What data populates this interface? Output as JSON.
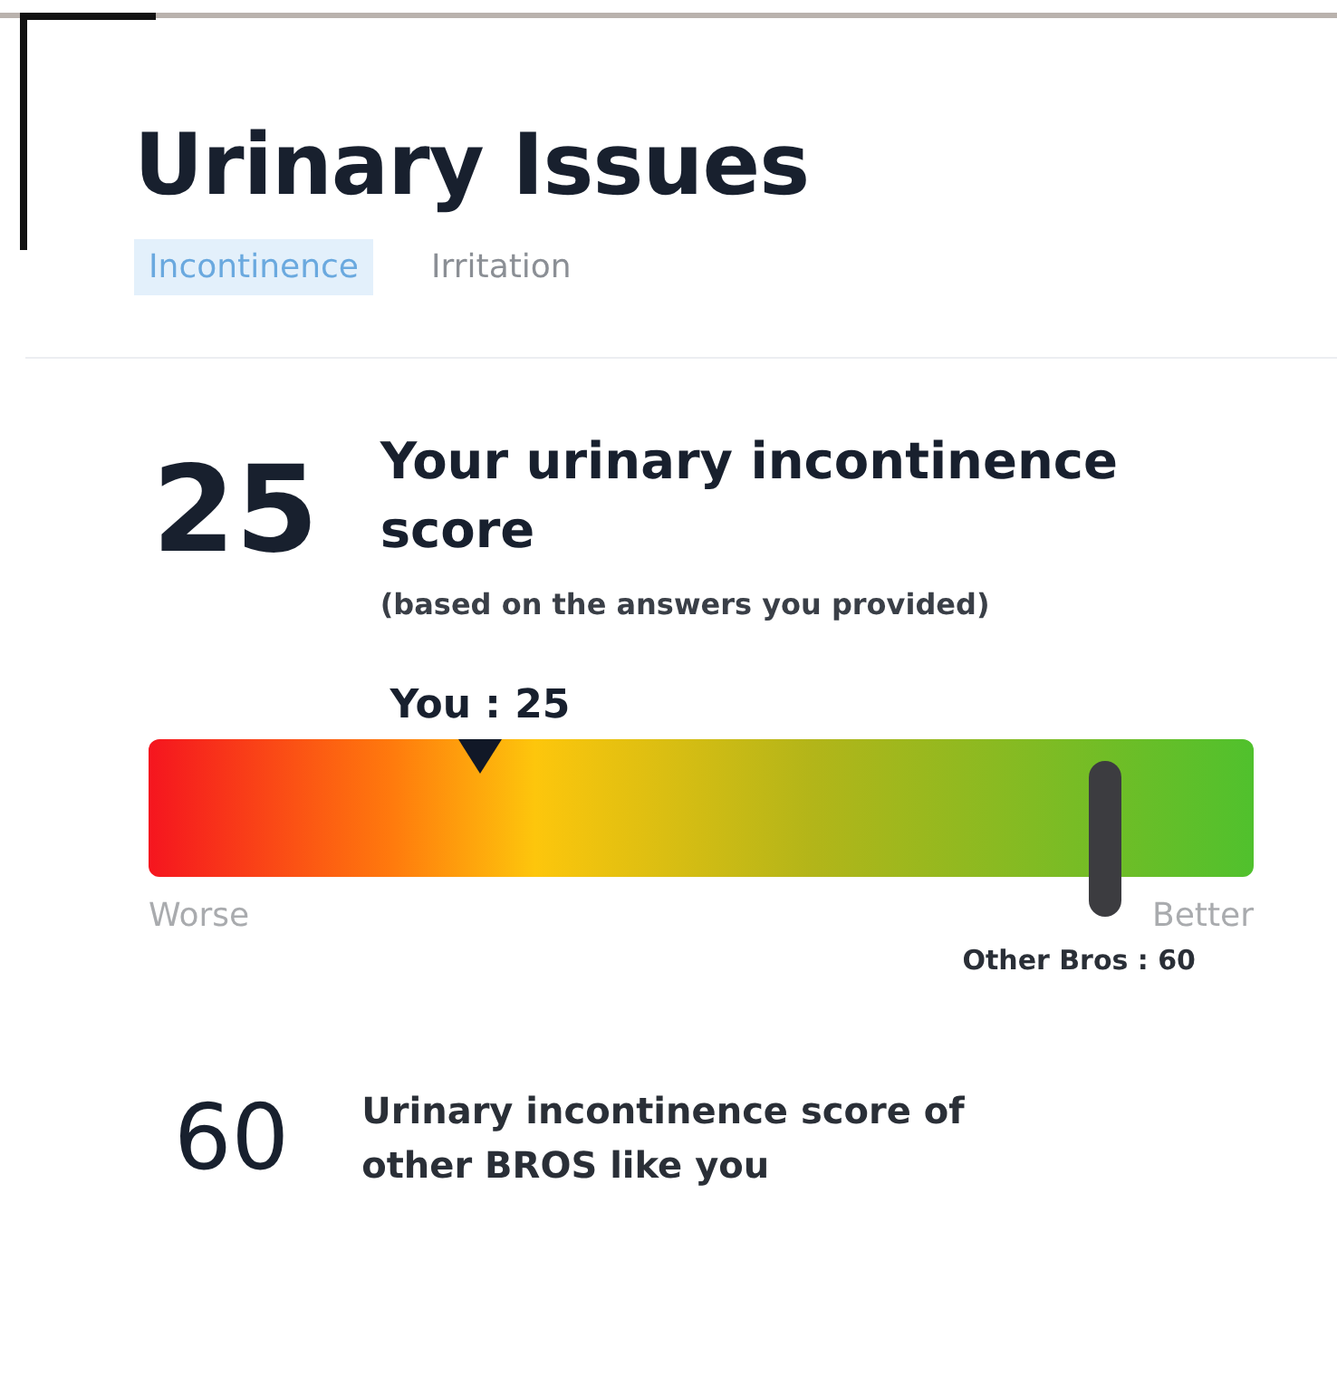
{
  "header": {
    "title": "Urinary Issues",
    "tabs": [
      {
        "label": "Incontinence",
        "selected": true
      },
      {
        "label": "Irritation",
        "selected": false
      }
    ]
  },
  "score": {
    "value": "25",
    "heading": "Your urinary incontinence score",
    "note": "(based on the answers you provided)"
  },
  "scale": {
    "you_label": "You : 25",
    "you_marker": {
      "level": 0.3
    },
    "others_marker": {
      "level": 0.865
    },
    "others_label": "Other Bros : 60",
    "min_label": "Worse",
    "max_label": "Better"
  },
  "others": {
    "value": "60",
    "caption": "Urinary incontinence score of other BROS like you"
  }
}
